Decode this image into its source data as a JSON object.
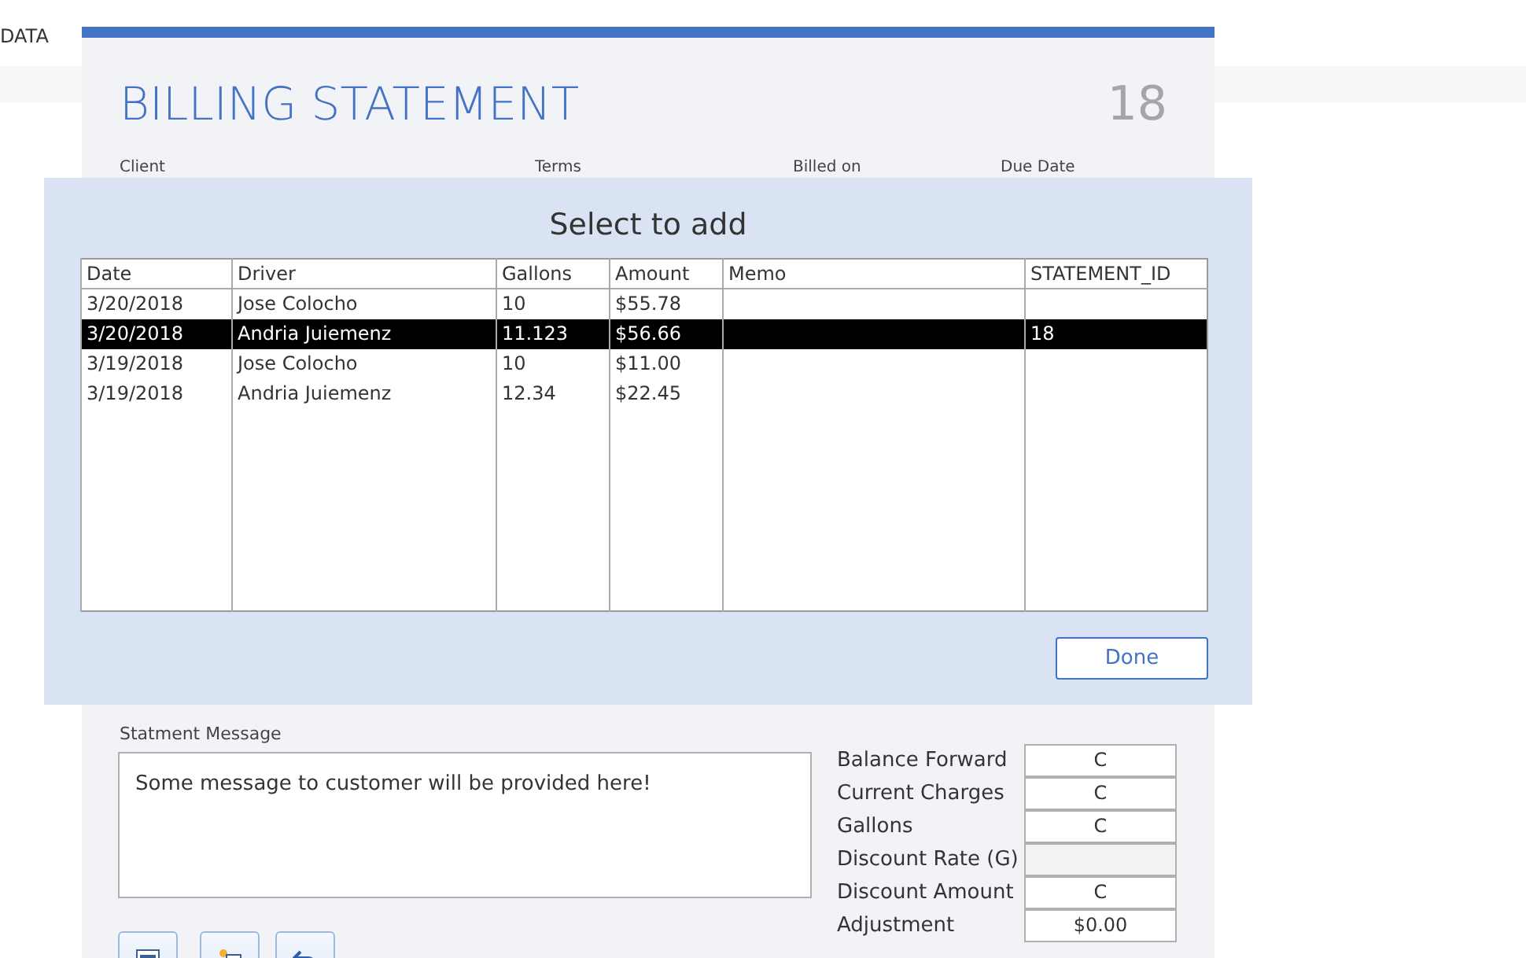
{
  "app_header": {
    "label": "DATA"
  },
  "statement": {
    "title": "BILLING STATEMENT",
    "number": "18",
    "labels": [
      "Client",
      "Terms",
      "Billed on",
      "Due Date"
    ]
  },
  "dialog": {
    "title": "Select to add",
    "columns": [
      "Date",
      "Driver",
      "Gallons",
      "Amount",
      "Memo",
      "STATEMENT_ID"
    ],
    "rows": [
      {
        "cells": [
          "3/20/2018",
          "Jose Colocho",
          "10",
          "$55.78",
          "",
          ""
        ],
        "selected": false
      },
      {
        "cells": [
          "3/20/2018",
          "Andria Juiemenz",
          "11.123",
          "$56.66",
          "",
          "18"
        ],
        "selected": true
      },
      {
        "cells": [
          "3/19/2018",
          "Jose Colocho",
          "10",
          "$11.00",
          "",
          ""
        ],
        "selected": false
      },
      {
        "cells": [
          "3/19/2018",
          "Andria Juiemenz",
          "12.34",
          "$22.45",
          "",
          ""
        ],
        "selected": false
      }
    ],
    "button": "Done"
  },
  "message": {
    "label": "Statment Message",
    "value": "Some message to customer will be provided here!"
  },
  "totals": [
    {
      "label": "Balance Forward",
      "value": "C",
      "disabled": false
    },
    {
      "label": "Current Charges",
      "value": "C",
      "disabled": false
    },
    {
      "label": "Gallons",
      "value": "C",
      "disabled": false
    },
    {
      "label": "Discount Rate (G)",
      "disabled": true
    },
    {
      "label": "Discount Amount",
      "value": "C",
      "disabled": false
    },
    {
      "label": "Adjustment",
      "value": "$0.00",
      "disabled": false
    }
  ],
  "toolbar": [
    {
      "kind": "report"
    },
    {
      "kind": "new"
    },
    {
      "kind": "undo"
    }
  ]
}
